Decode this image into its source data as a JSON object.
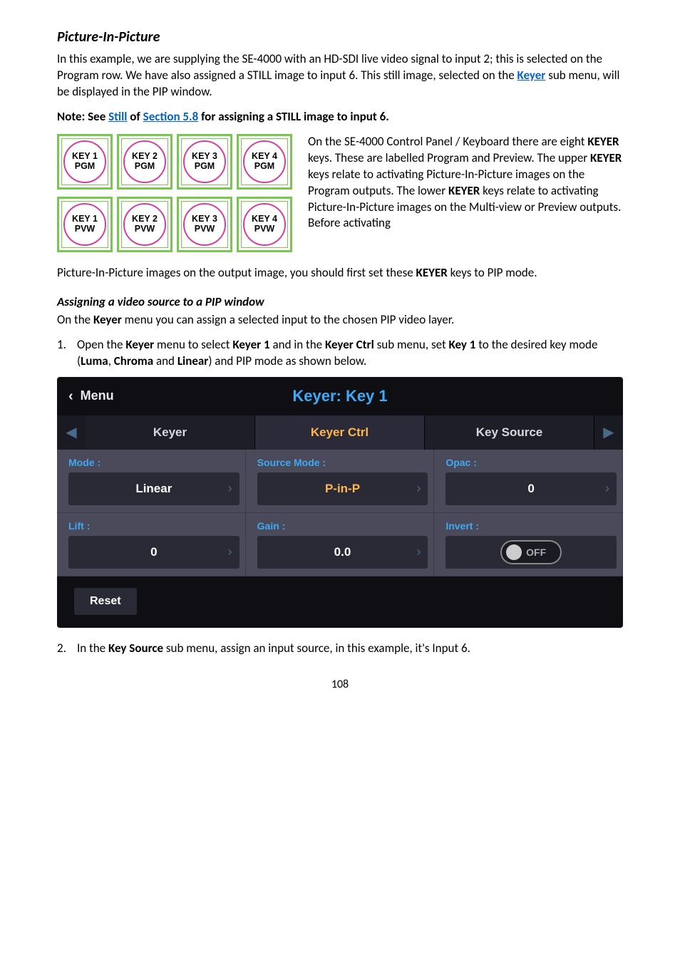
{
  "title": "Picture-In-Picture",
  "para1_a": "In this example, we are supplying the SE-4000 with an HD-SDI live video signal to input 2; this is selected on the Program row. We have also assigned a STILL image to input 6. This still image, selected on the",
  "para1_link": " Keyer",
  "para1_b": " sub menu, will be displayed in the PIP window.",
  "note_a": "Note: See",
  "note_link1": " Still",
  "note_b": " of ",
  "note_link2": "Section 5.8",
  "note_c": " for assigning a STILL image to input 6.",
  "keyer_diagram": {
    "pgm": [
      "KEY 1\nPGM",
      "KEY 2\nPGM",
      "KEY 3\nPGM",
      "KEY 4\nPGM"
    ],
    "pvw": [
      "KEY 1\nPVW",
      "KEY 2\nPVW",
      "KEY 3\nPVW",
      "KEY 4\nPVW"
    ]
  },
  "float_text_a": "On the SE-4000 Control Panel / Keyboard there are eight ",
  "float_text_b": "KEYER",
  "float_text_c": " keys. These are labelled Program and Preview. The upper ",
  "float_text_d": "KEYER",
  "float_text_e": " keys relate to activating Picture-In-Picture images on the Program outputs. The lower ",
  "float_text_f": "KEYER",
  "float_text_g": " keys relate to activating Picture-In-Picture images on the Multi-view or Preview outputs. Before activating ",
  "after_float_a": "Picture-In-Picture images on the output image, you should first set these ",
  "after_float_b": "KEYER",
  "after_float_c": " keys to PIP mode.",
  "subhead": "Assigning a video source to a PIP window",
  "para_assign_a": "On the ",
  "para_assign_b": "Keyer",
  "para_assign_c": " menu you can assign a selected input to the chosen PIP video layer.",
  "li1_a": "Open the ",
  "li1_b": "Keyer",
  "li1_c": " menu to select ",
  "li1_d": "Keyer 1",
  "li1_e": " and in the ",
  "li1_f": "Keyer Ctrl",
  "li1_g": " sub menu, set ",
  "li1_h": "Key 1",
  "li1_i": " to the desired key mode (",
  "li1_j": "Luma",
  "li1_k": ", ",
  "li1_l": "Chroma",
  "li1_m": " and ",
  "li1_n": "Linear",
  "li1_o": ") and PIP mode as shown below.",
  "ui": {
    "back": "Menu",
    "title": "Keyer: Key 1",
    "tabs": {
      "t1": "Keyer",
      "t2": "Keyer Ctrl",
      "t3": "Key Source"
    },
    "labels": {
      "mode": "Mode :",
      "source": "Source Mode :",
      "opac": "Opac :",
      "lift": "Lift :",
      "gain": "Gain :",
      "invert": "Invert :"
    },
    "values": {
      "mode": "Linear",
      "source": "P-in-P",
      "opac": "0",
      "lift": "0",
      "gain": "0.0",
      "invert": "OFF"
    },
    "reset": "Reset"
  },
  "li2_a": "In the ",
  "li2_b": "Key Source",
  "li2_c": " sub menu, assign an input source, in this example, it's Input 6.",
  "pagenum": "108"
}
